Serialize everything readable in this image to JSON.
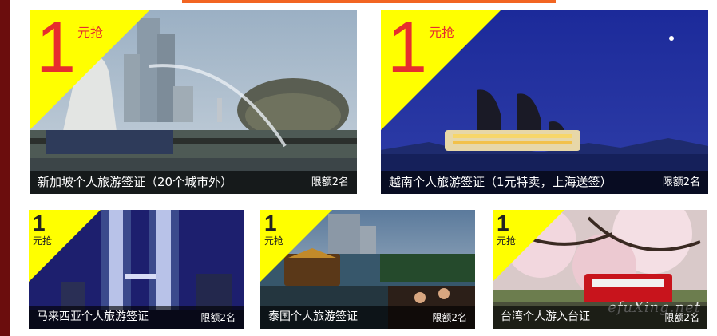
{
  "offers": [
    {
      "number": "1",
      "tag": "元抢",
      "title": "新加坡个人旅游签证（20个城市外）",
      "quota": "限额2名"
    },
    {
      "number": "1",
      "tag": "元抢",
      "title": "越南个人旅游签证（1元特卖，上海送签）",
      "quota": "限额2名"
    },
    {
      "number": "1",
      "tag": "元抢",
      "title": "马来西亚个人旅游签证",
      "quota": "限额2名"
    },
    {
      "number": "1",
      "tag": "元抢",
      "title": "泰国个人旅游签证",
      "quota": "限额2名"
    },
    {
      "number": "1",
      "tag": "元抢",
      "title": "台湾个人游入台证",
      "quota": "限额2名"
    }
  ],
  "watermark": "efuXing.net"
}
